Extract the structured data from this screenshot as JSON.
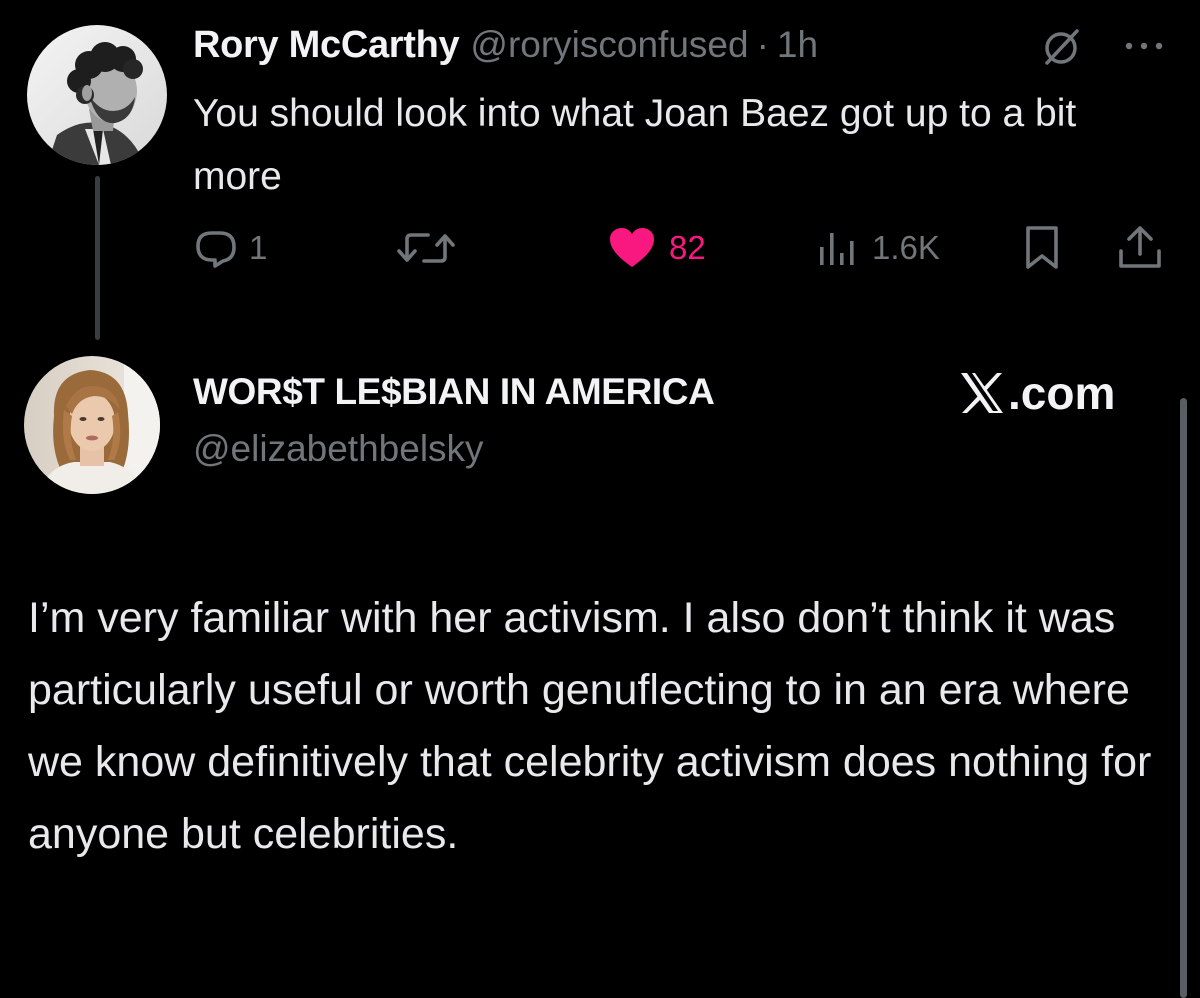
{
  "colors": {
    "background": "#000000",
    "text_primary": "#e7e9ea",
    "text_secondary": "#71767b",
    "like_active": "#f91880",
    "thread_line": "#3a3d40"
  },
  "reply_tweet": {
    "author_name": "Rory McCarthy",
    "handle": "@roryisconfused",
    "separator": "·",
    "timestamp": "1h",
    "text": "You should look into what Joan Baez got up to a bit more",
    "actions": {
      "reply_icon": "reply-icon",
      "reply_count": "1",
      "retweet_icon": "retweet-icon",
      "like_icon": "heart-filled-icon",
      "like_count": "82",
      "like_active": true,
      "views_icon": "views-icon",
      "views_count": "1.6K",
      "bookmark_icon": "bookmark-icon",
      "share_icon": "share-icon"
    },
    "header_icons": [
      "grok-icon",
      "more-icon"
    ]
  },
  "main_tweet": {
    "author_name": "WOR$T LE$BIAN IN AMERICA",
    "handle": "@elizabethbelsky",
    "site_brand": ".com",
    "site_brand_icon": "x-logo-icon",
    "text": "I’m very familiar with her activism. I also don’t think it was particularly useful or worth genuflecting to in an era where we know definitively that celebrity activism does nothing for anyone but celebrities."
  }
}
